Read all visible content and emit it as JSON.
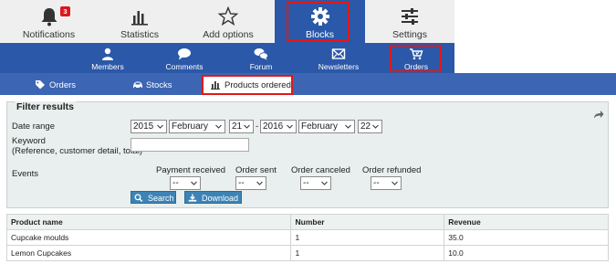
{
  "top_nav": {
    "items": [
      {
        "label": "Notifications",
        "icon": "bell-icon",
        "badge": "3"
      },
      {
        "label": "Statistics",
        "icon": "bar-chart-icon"
      },
      {
        "label": "Add options",
        "icon": "star-icon"
      },
      {
        "label": "Blocks",
        "icon": "gear-icon",
        "active": true
      },
      {
        "label": "Settings",
        "icon": "sliders-icon"
      }
    ]
  },
  "sub_nav": {
    "items": [
      {
        "label": "Members",
        "icon": "user-icon"
      },
      {
        "label": "Comments",
        "icon": "speech-bubble-icon"
      },
      {
        "label": "Forum",
        "icon": "forum-bubbles-icon"
      },
      {
        "label": "Newsletters",
        "icon": "envelope-icon"
      },
      {
        "label": "Orders",
        "icon": "cart-icon",
        "active": true
      }
    ]
  },
  "tabs": [
    {
      "label": "Orders",
      "icon": "tag-icon"
    },
    {
      "label": "Stocks",
      "icon": "car-icon"
    },
    {
      "label": "Products ordered",
      "icon": "bar-chart-icon",
      "active": true
    }
  ],
  "filter": {
    "legend": "Filter results",
    "date_range_label": "Date range",
    "date_from": {
      "year": "2015",
      "month": "February",
      "day": "21"
    },
    "date_separator": "-",
    "date_to": {
      "year": "2016",
      "month": "February",
      "day": "22"
    },
    "keyword_label": "Keyword",
    "keyword_hint": "(Reference, customer detail, total)",
    "keyword_value": "",
    "events_label": "Events",
    "events": [
      {
        "label": "Payment received",
        "value": "--"
      },
      {
        "label": "Order sent",
        "value": "--"
      },
      {
        "label": "Order canceled",
        "value": "--"
      },
      {
        "label": "Order refunded",
        "value": "--"
      }
    ],
    "search_button": "Search",
    "download_button": "Download"
  },
  "table": {
    "columns": [
      "Product name",
      "Number",
      "Revenue"
    ],
    "rows": [
      [
        "Cupcake moulds",
        "1",
        "35.0"
      ],
      [
        "Lemon Cupcakes",
        "1",
        "10.0"
      ]
    ]
  },
  "colors": {
    "nav_active": "#2b58a8",
    "tabs_bar": "#3c65b3",
    "highlight": "#e01818",
    "badge": "#d9181f",
    "button": "#3d83b5"
  }
}
